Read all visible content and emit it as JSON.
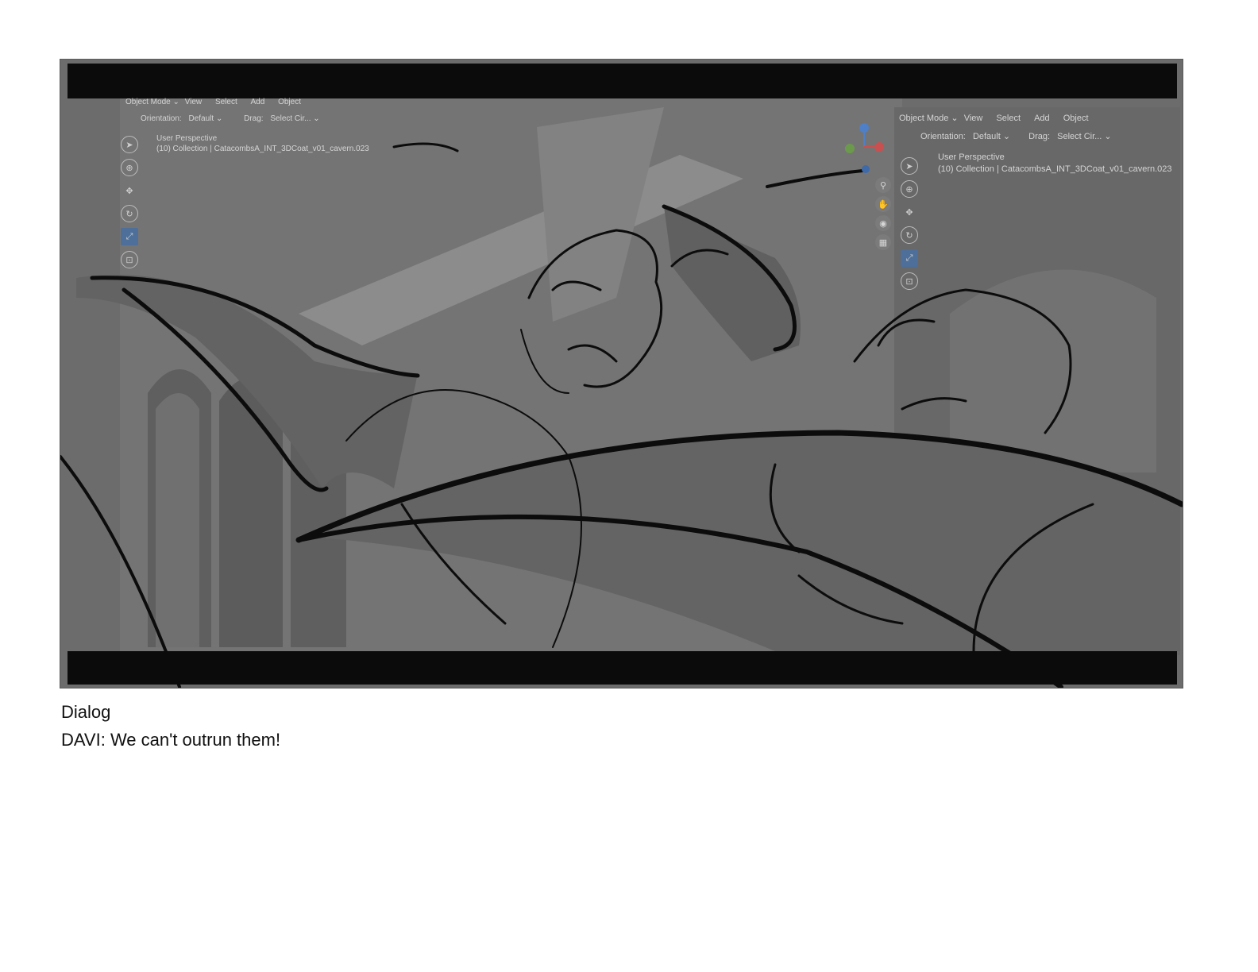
{
  "viewport_left": {
    "mode": "Object Mode",
    "menu": [
      "View",
      "Select",
      "Add",
      "Object"
    ],
    "orientation_label": "Orientation:",
    "orientation_value": "Default",
    "drag_label": "Drag:",
    "drag_value": "Select Cir...",
    "view_name": "User Perspective",
    "collection": "(10) Collection | CatacombsA_INT_3DCoat_v01_cavern.023"
  },
  "viewport_right": {
    "mode": "Object Mode",
    "menu": [
      "View",
      "Select",
      "Add",
      "Object"
    ],
    "orientation_label": "Orientation:",
    "orientation_value": "Default",
    "drag_label": "Drag:",
    "drag_value": "Select Cir...",
    "view_name": "User Perspective",
    "collection": "(10) Collection | CatacombsA_INT_3DCoat_v01_cavern.023"
  },
  "gizmo": {
    "z": "Z",
    "x": "X"
  },
  "icons": [
    "cursor-icon",
    "move-icon",
    "rotate-icon",
    "scale-icon",
    "transform-icon",
    "zoom-icon",
    "hand-icon",
    "camera-icon",
    "grid-icon"
  ],
  "colors": {
    "letterbox": "#0b0b0b",
    "active_tool": "#4d6f9a",
    "axis_z": "#4f7fc6",
    "axis_x": "#c85050",
    "axis_y": "#6c9a4c"
  },
  "caption": {
    "title": "Dialog",
    "line": "DAVI: We can't outrun them!"
  }
}
